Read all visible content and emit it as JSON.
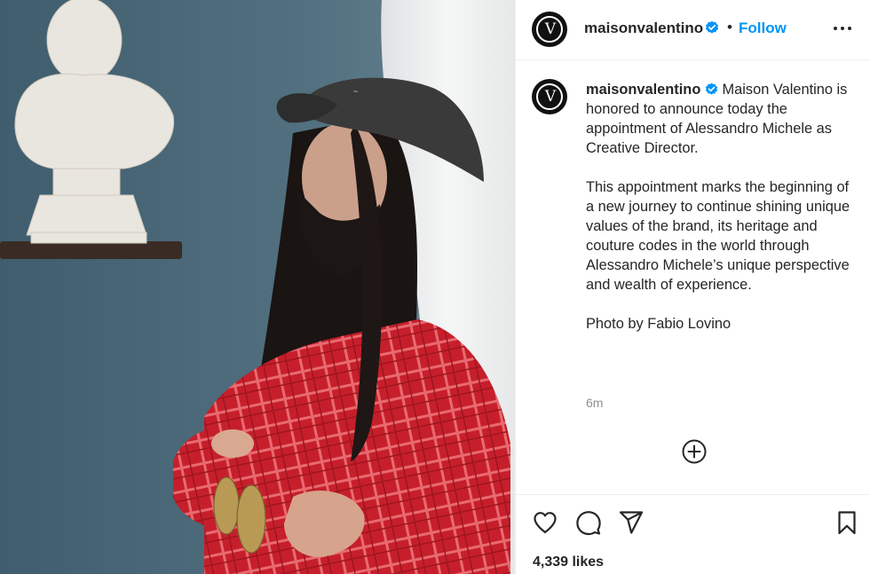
{
  "post": {
    "username": "maisonvalentino",
    "avatar_monogram": "V",
    "follow_label": "Follow",
    "separator": "•",
    "caption": {
      "username": "maisonvalentino",
      "line1": "Maison Valentino is honored to announce today the appointment of Alessandro Michele as Creative Director.",
      "line2": "This appointment marks the beginning of a new journey to continue shining unique values of the brand, its heritage and couture codes in the world through Alessandro Michele’s unique perspective and wealth of experience.",
      "line3": "Photo by Fabio Lovino"
    },
    "timestamp": "6m",
    "likes": "4,339 likes"
  },
  "icons": {
    "verified": "verified-badge-icon",
    "more": "more-options-icon",
    "add_comment": "add-comment-icon",
    "like": "heart-icon",
    "comment": "comment-icon",
    "share": "share-icon",
    "save": "bookmark-icon"
  },
  "colors": {
    "accent": "#0095f6",
    "text": "#262626",
    "muted": "#8e8e8e",
    "divider": "#efefef",
    "photo_wall": "#4c6776",
    "shirt_red": "#c8202c"
  }
}
